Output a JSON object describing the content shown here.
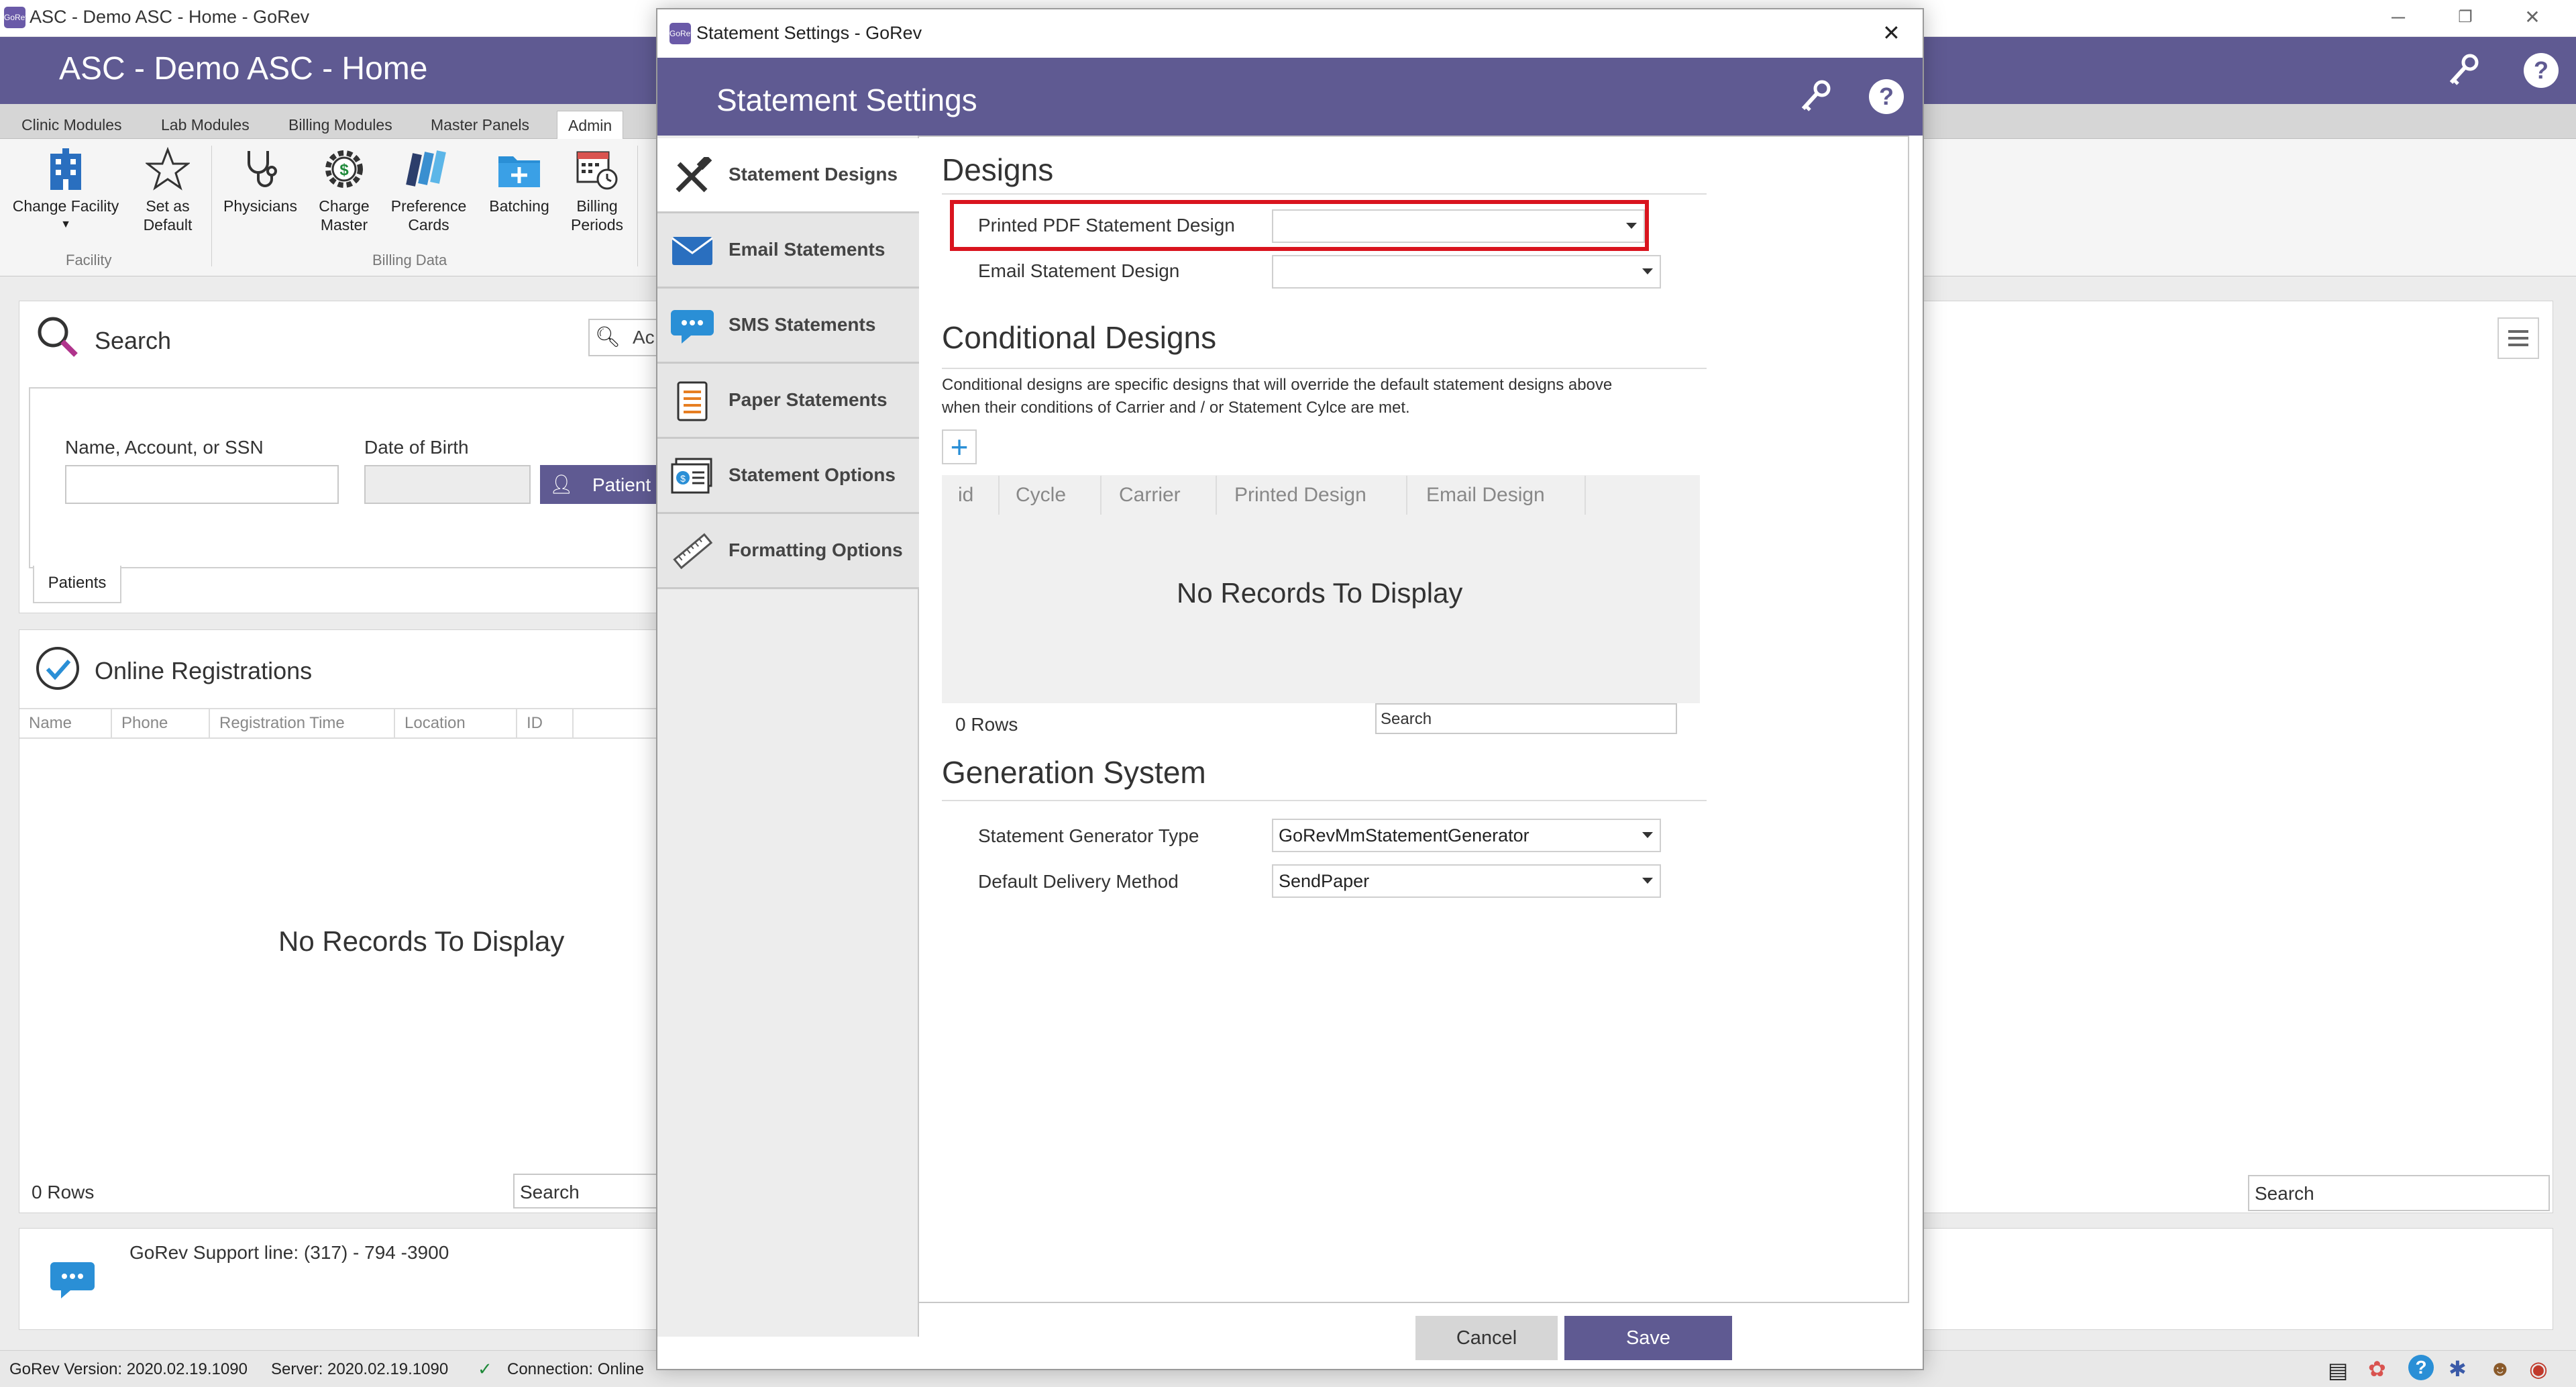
{
  "window": {
    "title": "ASC - Demo ASC - Home - GoRev",
    "app_icon": "GoRev"
  },
  "header": {
    "title": "ASC - Demo ASC - Home"
  },
  "ribbon_tabs": [
    "Clinic Modules",
    "Lab Modules",
    "Billing Modules",
    "Master Panels",
    "Admin"
  ],
  "ribbon": {
    "buttons": [
      {
        "label1": "Change Facility",
        "label2": "",
        "icon": "building-icon"
      },
      {
        "label1": "Set as",
        "label2": "Default",
        "icon": "star-icon"
      },
      {
        "label1": "Physicians",
        "label2": "",
        "icon": "stethoscope-icon"
      },
      {
        "label1": "Charge",
        "label2": "Master",
        "icon": "dollar-gear-icon"
      },
      {
        "label1": "Preference",
        "label2": "Cards",
        "icon": "cards-icon"
      },
      {
        "label1": "Batching",
        "label2": "",
        "icon": "folder-plus-icon"
      },
      {
        "label1": "Billing",
        "label2": "Periods",
        "icon": "calendar-clock-icon"
      }
    ],
    "groups": {
      "facility": "Facility",
      "billing_data": "Billing Data"
    }
  },
  "search_panel": {
    "title": "Search",
    "search_box_placeholder": "Ac",
    "name_label": "Name, Account, or SSN",
    "dob_label": "Date of Birth",
    "patient_button": "Patient",
    "tab_label": "Patients"
  },
  "online_reg": {
    "title": "Online Registrations",
    "columns": [
      "Name",
      "Phone",
      "Registration Time",
      "Location",
      "ID"
    ],
    "empty": "No Records To Display",
    "rows": "0 Rows",
    "search_placeholder": "Search"
  },
  "right_panel": {
    "search_placeholder": "Search"
  },
  "support": {
    "text": "GoRev Support line: (317) - 794 -3900"
  },
  "statusbar": {
    "version": "GoRev Version: 2020.02.19.1090",
    "server": "Server: 2020.02.19.1090",
    "connection": "Connection: Online"
  },
  "dialog": {
    "title": "Statement Settings - GoRev",
    "header": "Statement Settings",
    "nav": [
      {
        "label": "Statement Designs",
        "icon": "tools-icon"
      },
      {
        "label": "Email Statements",
        "icon": "envelope-icon"
      },
      {
        "label": "SMS Statements",
        "icon": "chat-bubble-icon"
      },
      {
        "label": "Paper Statements",
        "icon": "paper-icon"
      },
      {
        "label": "Statement Options",
        "icon": "options-card-icon"
      },
      {
        "label": "Formatting Options",
        "icon": "ruler-icon"
      }
    ],
    "designs": {
      "title": "Designs",
      "printed_label": "Printed PDF Statement Design",
      "printed_value": "",
      "email_label": "Email Statement Design",
      "email_value": ""
    },
    "conditional": {
      "title": "Conditional Designs",
      "description_line1": "Conditional designs are specific designs that will override the default statement designs above",
      "description_line2": "when their conditions of Carrier and / or Statement Cylce are met.",
      "add_symbol": "+",
      "columns": [
        "id",
        "Cycle",
        "Carrier",
        "Printed Design",
        "Email Design"
      ],
      "empty": "No Records To Display",
      "rows": "0 Rows",
      "search_placeholder": "Search"
    },
    "generation": {
      "title": "Generation System",
      "type_label": "Statement Generator Type",
      "type_value": "GoRevMmStatementGenerator",
      "delivery_label": "Default Delivery Method",
      "delivery_value": "SendPaper"
    },
    "cancel": "Cancel",
    "save": "Save"
  },
  "colors": {
    "header_purple": "#5f5a92",
    "highlight_red": "#d9141e",
    "save_button": "#5f5a92",
    "accent_blue": "#2a8fd6"
  }
}
